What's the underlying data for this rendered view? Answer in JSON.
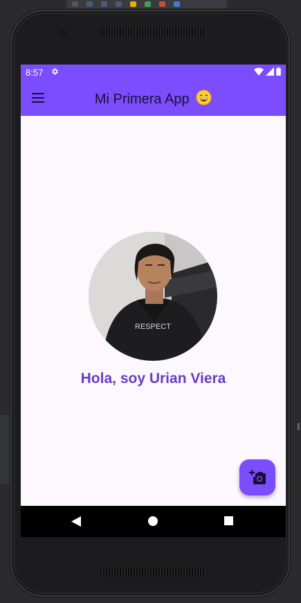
{
  "status_bar": {
    "time": "8:57",
    "background": "#7b4dff"
  },
  "app_bar": {
    "title": "Mi Primera App",
    "title_emoji": "smiling-face-icon",
    "background": "#7b4dff"
  },
  "profile": {
    "greeting": "Hola, soy Urian Viera",
    "greeting_color": "#6a3cbf",
    "shirt_text": "RESPECT"
  },
  "fab": {
    "icon": "add-a-photo-icon",
    "background": "#7b4dff"
  },
  "navigation": {
    "back": "back-triangle-icon",
    "home": "home-circle-icon",
    "recents": "recents-square-icon"
  }
}
